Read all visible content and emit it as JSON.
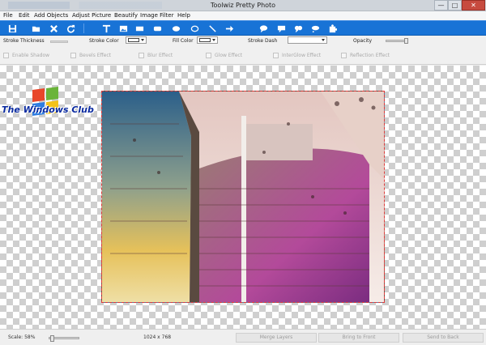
{
  "window": {
    "title": "Toolwiz Pretty Photo",
    "minimize": "—",
    "maximize": "□",
    "close": "✕"
  },
  "menu": [
    "File",
    "Edit",
    "Add Objects",
    "Adjust Picture",
    "Beautify",
    "Image Filter",
    "Help"
  ],
  "toolbar": {
    "icons": [
      "save-icon",
      "open-folder-icon",
      "delete-icon",
      "redo-icon",
      "text-icon",
      "picture-icon",
      "rectangle-icon",
      "rounded-rectangle-icon",
      "ellipse-icon",
      "line-icon",
      "arrow-icon",
      "speech-bubble-icon",
      "cloud-bubble-icon",
      "thought-bubble-icon",
      "puzzle-icon"
    ]
  },
  "properties": {
    "stroke_thickness": "Stroke Thickness",
    "stroke_color": "Stroke Color",
    "fill_color": "Fill Color",
    "stroke_dash": "Stroke Dash",
    "opacity": "Opacity"
  },
  "effects": [
    "Enable Shadow",
    "Bevels Effect",
    "Blur Effect",
    "Glow Effect",
    "InterGlow Effect",
    "Reflection Effect"
  ],
  "canvas": {
    "logo_text": "The Windows Club"
  },
  "status": {
    "scale": "Scale: 58%",
    "dimensions": "1024 x 768",
    "merge": "Merge Layers",
    "front": "Bring to Front",
    "back": "Send to Back"
  },
  "colors": {
    "toolbar": "#1873d6",
    "selection": "#e03a3a"
  }
}
